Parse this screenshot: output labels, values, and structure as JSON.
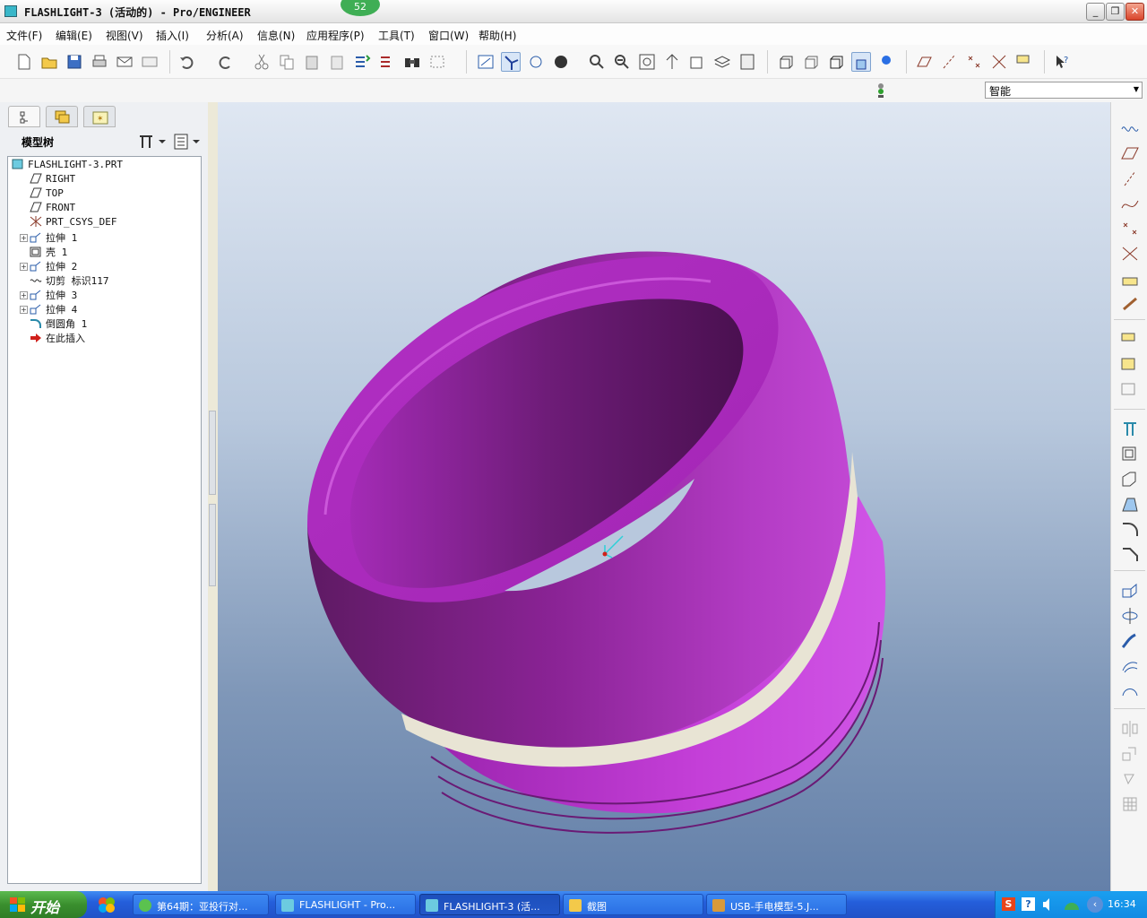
{
  "window": {
    "title": "FLASHLIGHT-3 (活动的) - Pro/ENGINEER",
    "badge": "52",
    "minimize": "_",
    "restore": "❐",
    "close": "✕"
  },
  "menu": [
    "文件(F)",
    "编辑(E)",
    "视图(V)",
    "插入(I)",
    "分析(A)",
    "信息(N)",
    "应用程序(P)",
    "工具(T)",
    "窗口(W)",
    "帮助(H)"
  ],
  "filter": {
    "value": "智能"
  },
  "panel": {
    "title": "模型树",
    "tree": [
      {
        "label": "FLASHLIGHT-3.PRT",
        "icon": "part-icon"
      },
      {
        "label": "RIGHT",
        "icon": "datum-plane-icon"
      },
      {
        "label": "TOP",
        "icon": "datum-plane-icon"
      },
      {
        "label": "FRONT",
        "icon": "datum-plane-icon"
      },
      {
        "label": "PRT_CSYS_DEF",
        "icon": "csys-icon"
      },
      {
        "label": "拉伸 1",
        "icon": "extrude-icon"
      },
      {
        "label": "壳 1",
        "icon": "shell-icon"
      },
      {
        "label": "拉伸 2",
        "icon": "extrude-icon"
      },
      {
        "label": "切剪 标识117",
        "icon": "cut-icon"
      },
      {
        "label": "拉伸 3",
        "icon": "extrude-icon"
      },
      {
        "label": "拉伸 4",
        "icon": "extrude-icon"
      },
      {
        "label": "倒圆角 1",
        "icon": "round-icon"
      },
      {
        "label": "在此插入",
        "icon": "insert-arrow-icon"
      }
    ]
  },
  "taskbar": {
    "start": "开始",
    "tasks": [
      "第64期：亚投行对...",
      "FLASHLIGHT - Pro...",
      "FLASHLIGHT-3 (活...",
      "截图",
      "USB-手电模型-5.J..."
    ],
    "clock": "16:34"
  },
  "colors": {
    "model": "#b227c4",
    "model_band": "#e8e4d4",
    "viewport_top": "#dfe7f2",
    "viewport_bottom": "#6480a9"
  }
}
